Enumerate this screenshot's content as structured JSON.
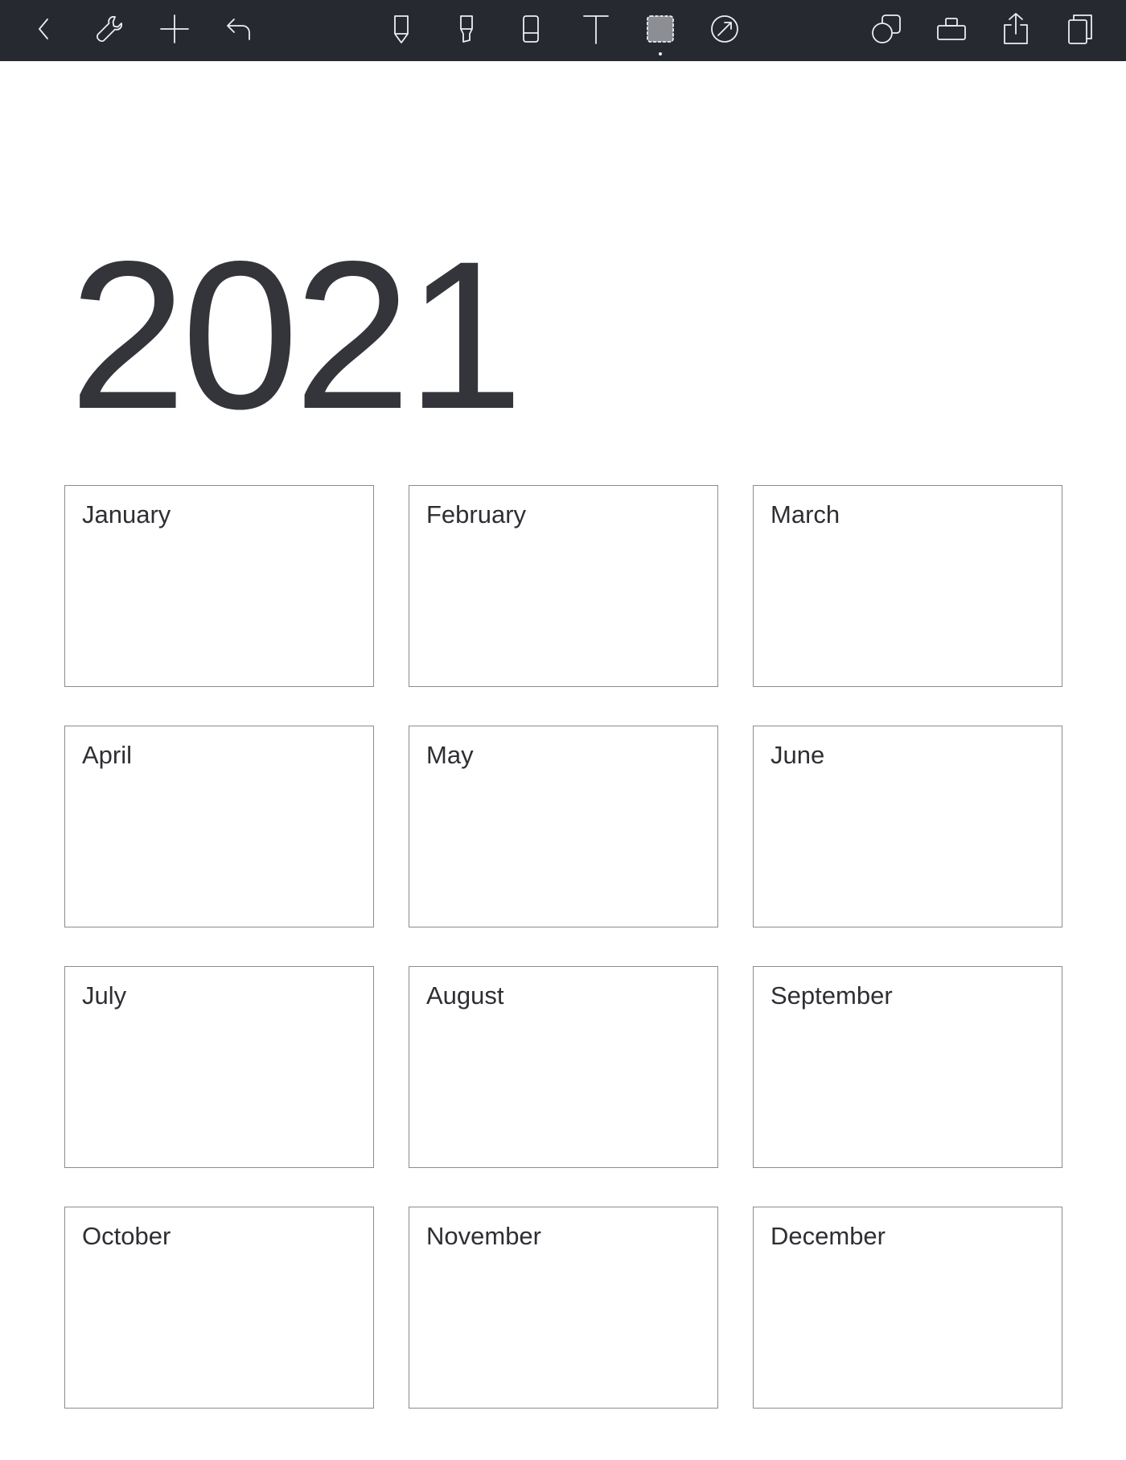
{
  "toolbar": {
    "left_tools": [
      {
        "name": "back",
        "icon": "chevron-left-icon"
      },
      {
        "name": "settings",
        "icon": "wrench-icon"
      },
      {
        "name": "add",
        "icon": "plus-icon"
      },
      {
        "name": "undo",
        "icon": "undo-icon"
      }
    ],
    "center_tools": [
      {
        "name": "pen",
        "icon": "pen-icon"
      },
      {
        "name": "highlighter",
        "icon": "highlighter-icon"
      },
      {
        "name": "eraser",
        "icon": "eraser-icon"
      },
      {
        "name": "text",
        "icon": "text-icon"
      },
      {
        "name": "lasso",
        "icon": "lasso-select-icon",
        "selected": true
      },
      {
        "name": "laser-pointer",
        "icon": "laser-pointer-icon"
      }
    ],
    "right_tools": [
      {
        "name": "shapes",
        "icon": "shapes-icon"
      },
      {
        "name": "elements",
        "icon": "elements-icon"
      },
      {
        "name": "share",
        "icon": "share-icon"
      },
      {
        "name": "pages",
        "icon": "pages-icon"
      }
    ]
  },
  "page": {
    "year": "2021",
    "months": [
      {
        "label": "January"
      },
      {
        "label": "February"
      },
      {
        "label": "March"
      },
      {
        "label": "April"
      },
      {
        "label": "May"
      },
      {
        "label": "June"
      },
      {
        "label": "July"
      },
      {
        "label": "August"
      },
      {
        "label": "September"
      },
      {
        "label": "October"
      },
      {
        "label": "November"
      },
      {
        "label": "December"
      }
    ]
  },
  "colors": {
    "toolbar_bg": "#262930",
    "icon": "#eceef2",
    "text": "#2e2f33",
    "box_border": "#8a8c90"
  }
}
